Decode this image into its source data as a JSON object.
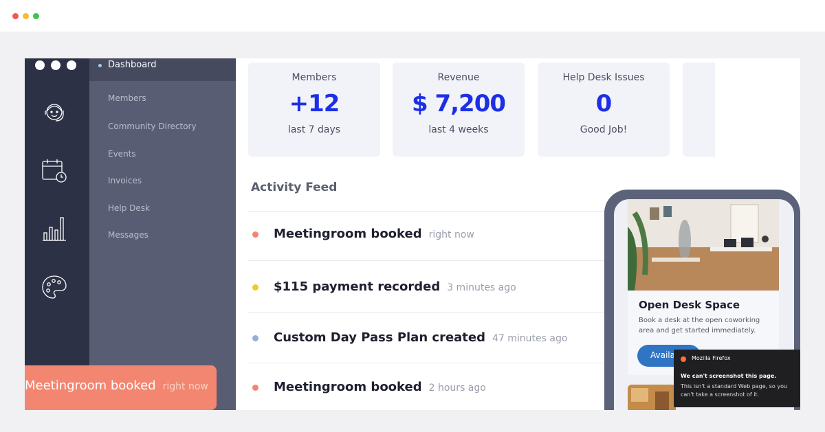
{
  "dashboard_label": "Dashboard",
  "nav": [
    "Members",
    "Community Directory",
    "Events",
    "Invoices",
    "Help Desk",
    "Messages"
  ],
  "rail_icons": [
    "support-agent-icon",
    "calendar-clock-icon",
    "bar-chart-icon",
    "palette-icon"
  ],
  "stats": [
    {
      "title": "Members",
      "value": "+12",
      "sub": "last 7 days"
    },
    {
      "title": "Revenue",
      "value": "$ 7,200",
      "sub": "last 4 weeks"
    },
    {
      "title": "Help Desk Issues",
      "value": "0",
      "sub": "Good Job!"
    }
  ],
  "feed": {
    "title": "Activity Feed",
    "items": [
      {
        "message": "Meetingroom booked",
        "time": "right now",
        "color": "#f38670"
      },
      {
        "message": "$115 payment recorded",
        "time": "3 minutes ago",
        "color": "#f5c92a"
      },
      {
        "message": "Custom Day Pass Plan created",
        "time": "47 minutes ago",
        "color": "#8fb1d8"
      },
      {
        "message": "Meetingroom booked",
        "time": "2 hours ago",
        "color": "#f38670"
      }
    ]
  },
  "toast": {
    "message": "Meetingroom booked",
    "time": "right now"
  },
  "phone_card": {
    "title": "Open Desk Space",
    "description": "Book a desk at the open coworking area and get started immediately.",
    "button": "Availa"
  },
  "firefox": {
    "app": "Mozilla Firefox",
    "line1": "We can't screenshot this page.",
    "line2": "This isn't a standard Web page, so you can't take a screenshot of it."
  },
  "colors": {
    "accent": "#1c2fe6",
    "rail": "#2c3146",
    "subnav": "#595d74",
    "toast": "#f38670",
    "button": "#2f75c4"
  }
}
